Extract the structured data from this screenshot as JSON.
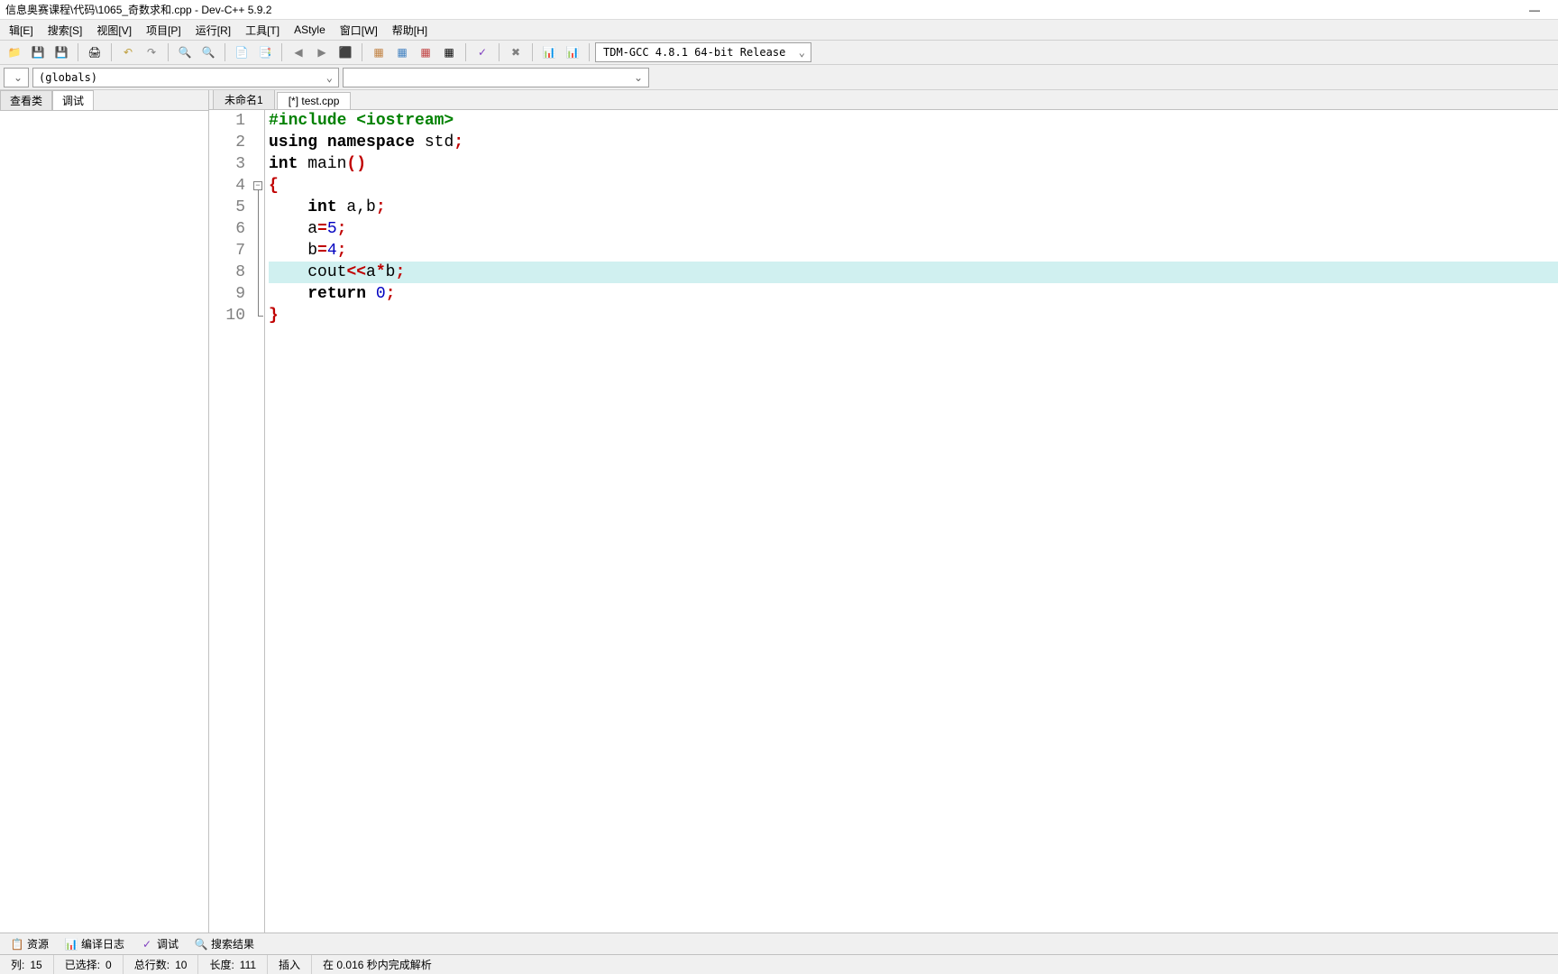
{
  "title": "信息奥赛课程\\代码\\1065_奇数求和.cpp - Dev-C++ 5.9.2",
  "menu": [
    "辑[E]",
    "搜索[S]",
    "视图[V]",
    "项目[P]",
    "运行[R]",
    "工具[T]",
    "AStyle",
    "窗口[W]",
    "帮助[H]"
  ],
  "compiler": "TDM-GCC 4.8.1 64-bit Release",
  "globals": "(globals)",
  "sidebar_tabs": {
    "classes": "查看类",
    "debug": "调试"
  },
  "file_tabs": [
    {
      "label": "未命名1",
      "active": false
    },
    {
      "label": "[*] test.cpp",
      "active": true
    }
  ],
  "code": {
    "l1": {
      "pp": "#include <iostream>"
    },
    "l2": {
      "kw1": "using",
      "kw2": "namespace",
      "id": " std",
      "sc": ";"
    },
    "l3": {
      "kw1": "int",
      "id": " main",
      "par": "()"
    },
    "l4": {
      "br": "{"
    },
    "l5": {
      "kw": "int",
      "rest": " a,b",
      "sc": ";"
    },
    "l6": {
      "a": "a",
      "eq": "=",
      "n": "5",
      "sc": ";"
    },
    "l7": {
      "a": "b",
      "eq": "=",
      "n": "4",
      "sc": ";"
    },
    "l8": {
      "c": "cout",
      "o1": "<<",
      "a": "a",
      "o2": "*",
      "b": "b",
      "sc": ";"
    },
    "l9": {
      "kw": "return",
      "sp": " ",
      "n": "0",
      "sc": ";"
    },
    "l10": {
      "br": "}"
    }
  },
  "line_numbers": [
    "1",
    "2",
    "3",
    "4",
    "5",
    "6",
    "7",
    "8",
    "9",
    "10"
  ],
  "bottom_tabs": {
    "res": "资源",
    "log": "编译日志",
    "debug": "调试",
    "search": "搜索结果"
  },
  "status": {
    "col_label": "列:",
    "col_val": "15",
    "sel_label": "已选择:",
    "sel_val": "0",
    "lines_label": "总行数:",
    "lines_val": "10",
    "len_label": "长度:",
    "len_val": "111",
    "mode": "插入",
    "parse": "在 0.016 秒内完成解析"
  }
}
